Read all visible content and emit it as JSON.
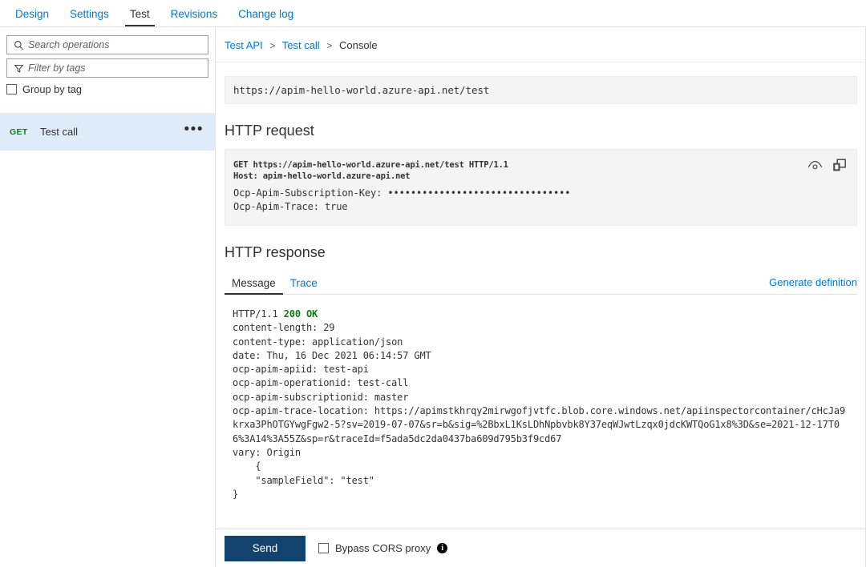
{
  "tabs": [
    {
      "label": "Design",
      "active": false
    },
    {
      "label": "Settings",
      "active": false
    },
    {
      "label": "Test",
      "active": true
    },
    {
      "label": "Revisions",
      "active": false
    },
    {
      "label": "Change log",
      "active": false
    }
  ],
  "sidebar": {
    "search": {
      "placeholder": "Search operations",
      "value": "",
      "icon": "search-icon"
    },
    "filter": {
      "placeholder": "Filter by tags",
      "value": "",
      "icon": "filter-icon"
    },
    "group_by_tag": {
      "label": "Group by tag",
      "checked": false
    },
    "operations": [
      {
        "verb": "GET",
        "name": "Test call",
        "selected": true,
        "more": "•••"
      }
    ]
  },
  "breadcrumb": {
    "items": [
      "Test API",
      "Test call",
      "Console"
    ],
    "separator": ">"
  },
  "console": {
    "url": "https://apim-hello-world.azure-api.net/test",
    "request": {
      "title": "HTTP request",
      "line1": "GET https://apim-hello-world.azure-api.net/test HTTP/1.1",
      "line2": "Host: apim-hello-world.azure-api.net",
      "header_subscription_key_name": "Ocp-Apim-Subscription-Key:",
      "header_subscription_key_value": "••••••••••••••••••••••••••••••••",
      "header_trace": "Ocp-Apim-Trace: true",
      "reveal_icon": "eye-icon",
      "copy_icon": "copy-icon"
    },
    "response": {
      "title": "HTTP response",
      "tabs": [
        {
          "label": "Message",
          "active": true
        },
        {
          "label": "Trace",
          "active": false
        }
      ],
      "generate_definition_label": "Generate definition",
      "status_line_prefix": "HTTP/1.1 ",
      "status_code": "200 OK",
      "headers_and_body": "content-length: 29\ncontent-type: application/json\ndate: Thu, 16 Dec 2021 06:14:57 GMT\nocp-apim-apiid: test-api\nocp-apim-operationid: test-call\nocp-apim-subscriptionid: master\nocp-apim-trace-location: https://apimstkhrqy2mirwgofjvtfc.blob.core.windows.net/apiinspectorcontainer/cHcJa9krxa3PhOTGYwgFgw2-5?sv=2019-07-07&sr=b&sig=%2BbxL1KsLDhNpbvbk8Y37eqWJwtLzqx0jdcKWTQoG1x8%3D&se=2021-12-17T06%3A14%3A55Z&sp=r&traceId=f5ada5dc2da0437ba609d795b3f9cd67\nvary: Origin\n    {\n    \"sampleField\": \"test\"\n}"
    }
  },
  "footer": {
    "send_label": "Send",
    "bypass_cors": {
      "label": "Bypass CORS proxy",
      "checked": false
    },
    "info_icon": "info-icon",
    "info_glyph": "i"
  },
  "colors": {
    "link": "#0078d4",
    "selected_row": "#deecf9",
    "verb_get": "#107c10",
    "status_ok": "#107c10",
    "send_button": "#11436e"
  }
}
